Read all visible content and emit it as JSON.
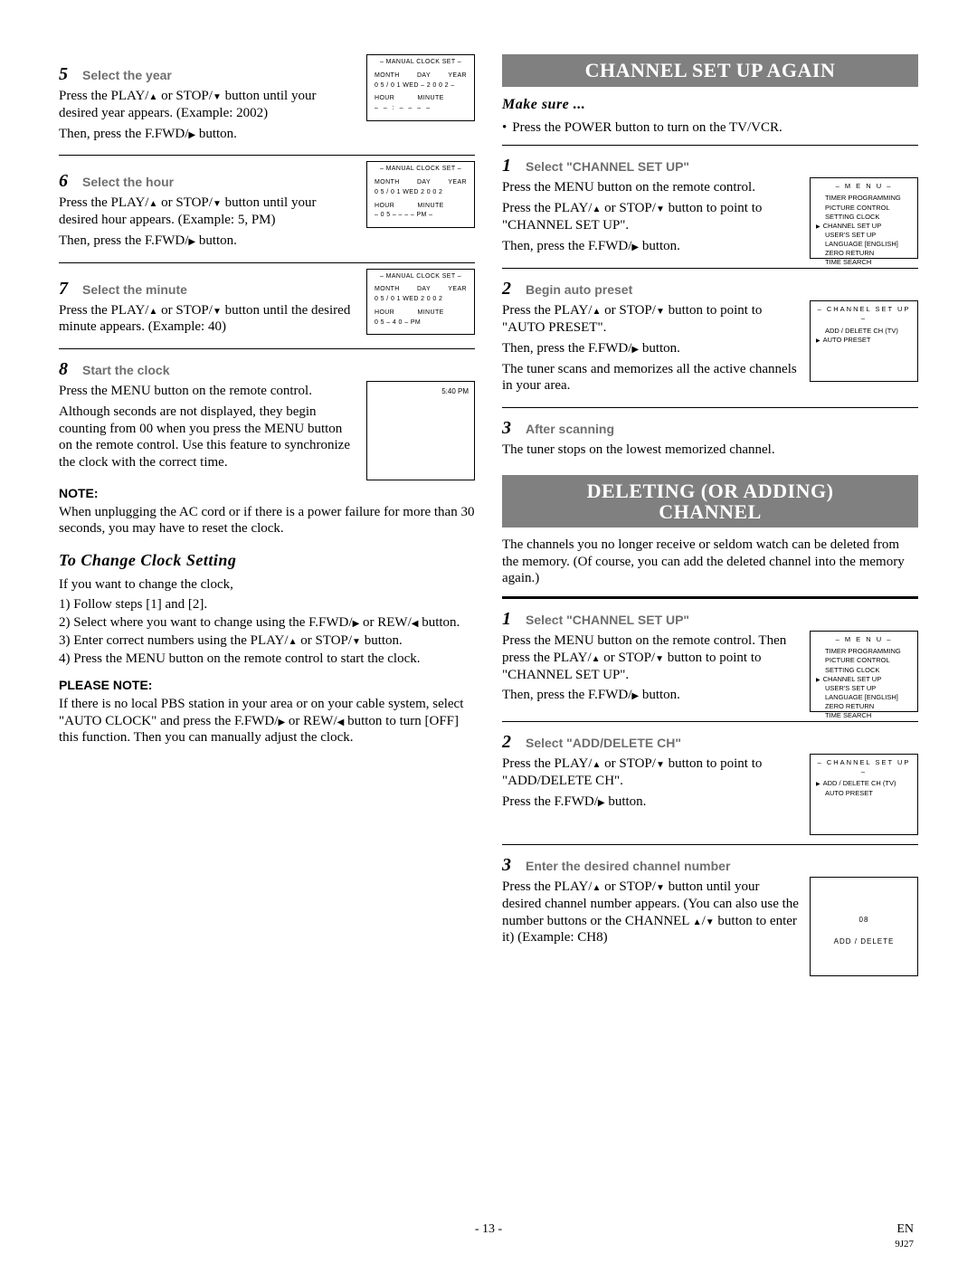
{
  "left": {
    "s5": {
      "num": "5",
      "title": "Select the year",
      "p1a": "Press the PLAY/",
      "p1b": " or STOP/",
      "p1c": " button until your desired year appears. (Example: 2002)",
      "p2a": "Then, press the F.FWD/",
      "p2b": " button.",
      "mini": {
        "title": "– MANUAL CLOCK SET –",
        "h1a": "MONTH",
        "h1b": "DAY",
        "h1c": "YEAR",
        "v1": "0 5  /  0 1  WED – 2 0 0 2 –",
        "h2a": "HOUR",
        "h2b": "MINUTE",
        "v2": "– –  :  – –  – –"
      }
    },
    "s6": {
      "num": "6",
      "title": "Select the hour",
      "p1a": "Press the PLAY/",
      "p1b": " or STOP/",
      "p1c": " button until your desired hour appears. (Example: 5, PM)",
      "p2a": "Then, press the F.FWD/",
      "p2b": " button.",
      "mini": {
        "title": "– MANUAL CLOCK SET –",
        "h1a": "MONTH",
        "h1b": "DAY",
        "h1c": "YEAR",
        "v1": "0 5  /  0 1  WED  2 0 0 2",
        "h2a": "HOUR",
        "h2b": "MINUTE",
        "v2": "– 0 5 –  – –  – PM –"
      }
    },
    "s7": {
      "num": "7",
      "title": "Select the minute",
      "p1a": "Press the PLAY/",
      "p1b": " or STOP/",
      "p1c": " button until the desired minute appears. (Example: 40)",
      "mini": {
        "title": "– MANUAL CLOCK SET –",
        "h1a": "MONTH",
        "h1b": "DAY",
        "h1c": "YEAR",
        "v1": "0 5  /  0 1  WED  2 0 0 2",
        "h2a": "HOUR",
        "h2b": "MINUTE",
        "v2": "0 5  – 4 0 –  PM"
      }
    },
    "s8": {
      "num": "8",
      "title": "Start the clock",
      "p1": "Press the MENU button on the remote control.",
      "p2": "Although seconds are not displayed, they begin counting from 00 when you press the MENU button on the remote control. Use this feature to synchronize the clock with the correct time.",
      "miniTR": "5:40 PM"
    },
    "note_head": "NOTE:",
    "note_body": "When unplugging the AC cord or if there is a power failure for more than 30 seconds, you may have to reset the clock.",
    "change_head": "To Change Clock Setting",
    "change_intro": "If you want to change the clock,",
    "change1": "1) Follow steps [1] and [2].",
    "change2a": "2) Select where you want to change using the F.FWD/",
    "change2b": " or REW/",
    "change2c": " button.",
    "change3a": "3) Enter correct numbers using the PLAY/",
    "change3b": " or STOP/",
    "change3c": " button.",
    "change4": "4) Press the MENU button on the remote control to start the clock.",
    "please_head": "PLEASE NOTE:",
    "please_a": "If there is no local PBS station in your area or on your cable system, select \"AUTO CLOCK\" and press the F.FWD/",
    "please_b": " or REW/",
    "please_c": " button to turn [OFF] this function. Then you can manually adjust the clock."
  },
  "right": {
    "bar1": "CHANNEL SET UP AGAIN",
    "make_sure": "Make sure ...",
    "ms1": "Press the POWER button to turn on the TV/VCR.",
    "c1": {
      "num": "1",
      "title": "Select \"CHANNEL SET UP\"",
      "p1": "Press the MENU button on the remote control.",
      "p2a": "Press the PLAY/",
      "p2b": " or STOP/",
      "p2c": " button to point to \"CHANNEL SET UP\".",
      "p3a": "Then, press the F.FWD/",
      "p3b": " button.",
      "menu": {
        "title": "– M E N U –",
        "items": [
          "TIMER PROGRAMMING",
          "PICTURE CONTROL",
          "SETTING CLOCK",
          "CHANNEL SET UP",
          "USER'S SET UP",
          "LANGUAGE   [ENGLISH]",
          "ZERO RETURN",
          "TIME SEARCH"
        ],
        "cursorIndex": 3
      }
    },
    "c2": {
      "num": "2",
      "title": "Begin auto preset",
      "p1a": "Press the PLAY/",
      "p1b": " or STOP/",
      "p1c": " button to point to \"AUTO PRESET\".",
      "p2a": "Then, press the F.FWD/",
      "p2b": " button.",
      "p3": "The tuner scans and memorizes all the active channels in your area.",
      "menu": {
        "title": "– CHANNEL SET UP –",
        "items": [
          "ADD / DELETE CH (TV)",
          "AUTO PRESET"
        ],
        "cursorIndex": 1
      }
    },
    "c3": {
      "num": "3",
      "title": "After scanning",
      "p1": "The tuner stops on the lowest memorized channel."
    },
    "bar2a": "DELETING (OR ADDING)",
    "bar2b": "CHANNEL",
    "del_intro": "The channels you no longer receive or seldom watch can be deleted from the memory. (Of course, you can add the deleted channel into the memory again.)",
    "d1": {
      "num": "1",
      "title": "Select \"CHANNEL SET UP\"",
      "p1a": "Press the MENU button on the remote control. Then press the PLAY/",
      "p1b": " or STOP/",
      "p1c": " button to point to \"CHANNEL SET UP\".",
      "p2a": "Then, press the F.FWD/",
      "p2b": " button.",
      "menu": {
        "title": "– M E N U –",
        "items": [
          "TIMER PROGRAMMING",
          "PICTURE CONTROL",
          "SETTING CLOCK",
          "CHANNEL SET UP",
          "USER'S SET UP",
          "LANGUAGE   [ENGLISH]",
          "ZERO RETURN",
          "TIME SEARCH"
        ],
        "cursorIndex": 3
      }
    },
    "d2": {
      "num": "2",
      "title": "Select \"ADD/DELETE CH\"",
      "p1a": "Press the PLAY/",
      "p1b": " or STOP/",
      "p1c": " button to point to \"ADD/DELETE CH\".",
      "p2a": "Press the F.FWD/",
      "p2b": " button.",
      "menu": {
        "title": "– CHANNEL SET UP –",
        "items": [
          "ADD / DELETE CH (TV)",
          "AUTO PRESET"
        ],
        "cursorIndex": 0
      }
    },
    "d3": {
      "num": "3",
      "title": "Enter the desired channel number",
      "p1a": "Press the PLAY/",
      "p1b": " or STOP/",
      "p1c": " button until your desired channel number appears. (You can also use the number buttons  or the CHANNEL ",
      "p1d": "/",
      "p1e": " button to enter it) (Example: CH8)",
      "mini": {
        "num": "08",
        "label": "ADD / DELETE"
      }
    }
  },
  "foot": {
    "page": "- 13 -",
    "lang": "EN",
    "code": "9J27"
  },
  "tri": {
    "up": "▲",
    "down": "▼",
    "right": "▶",
    "left": "◀"
  }
}
